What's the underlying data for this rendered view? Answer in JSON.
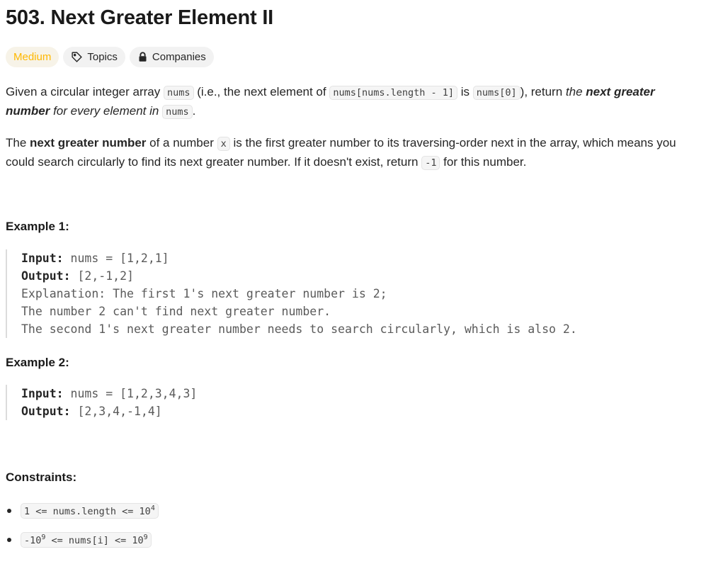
{
  "title": "503. Next Greater Element II",
  "tags": {
    "difficulty": "Medium",
    "topics": "Topics",
    "companies": "Companies"
  },
  "description": {
    "p1": {
      "t1": "Given a circular integer array ",
      "c1": "nums",
      "t2": " (i.e., the next element of ",
      "c2": "nums[nums.length - 1]",
      "t3": " is ",
      "c3": "nums[0]",
      "t4": "), return ",
      "i1": "the ",
      "b1": "next greater",
      "b2": "number",
      "i2": " for every element in ",
      "c4": "nums",
      "t5": "."
    },
    "p2": {
      "b1": "next greater number",
      "t0": "The ",
      "t1": " of a number ",
      "c1": "x",
      "t2": " is the first greater number to its traversing-order next in the array, which means you",
      "t3": "could search circularly to find its next greater number. If it doesn't exist, return ",
      "c2": "-1",
      "t4": " for this number."
    }
  },
  "examples": [
    {
      "heading": "Example 1:",
      "input_label": "Input:",
      "input": " nums = [1,2,1]",
      "output_label": "Output:",
      "output": " [2,-1,2]",
      "explanation_lines": [
        "Explanation: The first 1's next greater number is 2;",
        "The number 2 can't find next greater number.",
        "The second 1's next greater number needs to search circularly, which is also 2."
      ]
    },
    {
      "heading": "Example 2:",
      "input_label": "Input:",
      "input": " nums = [1,2,3,4,3]",
      "output_label": "Output:",
      "output": " [2,3,4,-1,4]"
    }
  ],
  "constraints": {
    "heading": "Constraints:",
    "items": [
      {
        "pre": "1 <= nums.length <= 10",
        "sup": "4",
        "post": ""
      },
      {
        "pre": "-10",
        "sup": "9",
        "post": " <= nums[i] <= 10",
        "sup2": "9"
      }
    ]
  },
  "icons": {
    "topics": "tag-icon",
    "companies": "lock-icon"
  },
  "colors": {
    "medium": "#ffb800"
  }
}
